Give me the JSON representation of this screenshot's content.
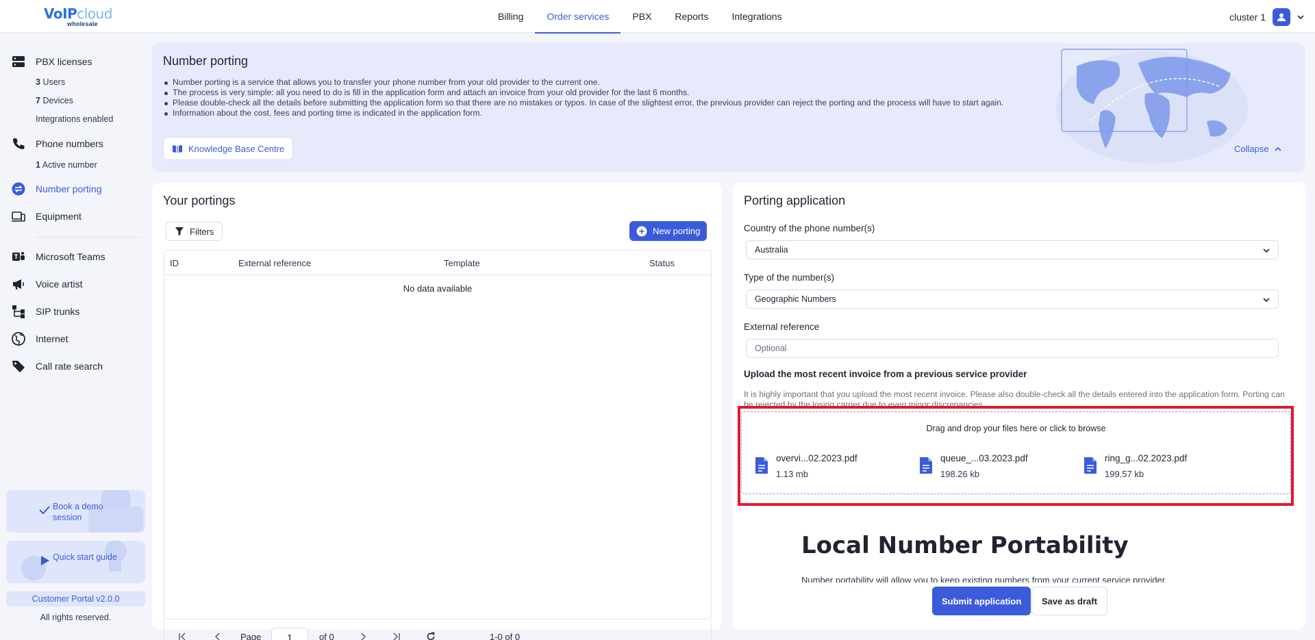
{
  "logo": {
    "brand_main": "VoIP",
    "brand_accent": "cloud",
    "brand_sub": "wholesale"
  },
  "nav": {
    "items": [
      {
        "label": "Billing",
        "active": false
      },
      {
        "label": "Order services",
        "active": true
      },
      {
        "label": "PBX",
        "active": false
      },
      {
        "label": "Reports",
        "active": false
      },
      {
        "label": "Integrations",
        "active": false
      }
    ]
  },
  "user": {
    "name": "cluster 1"
  },
  "sidebar": {
    "pbx_licenses": "PBX licenses",
    "users": {
      "count": "3",
      "label": "Users"
    },
    "devices": {
      "count": "7",
      "label": "Devices"
    },
    "integrations": "Integrations enabled",
    "phone_numbers": "Phone numbers",
    "active_number": {
      "count": "1",
      "label": "Active number"
    },
    "number_porting": "Number porting",
    "equipment": "Equipment",
    "microsoft_teams": "Microsoft Teams",
    "voice_artist": "Voice artist",
    "sip_trunks": "SIP trunks",
    "internet": "Internet",
    "call_rate_search": "Call rate search",
    "book_demo": "Book a demo session",
    "quick_start": "Quick start guide",
    "version": "Customer Portal v2.0.0",
    "rights": "All rights reserved."
  },
  "banner": {
    "title": "Number porting",
    "bullets": [
      "Number porting is a service that allows you to transfer your phone number from your old provider to the current one.",
      "The process is very simple: all you need to do is fill in the application form and attach an invoice from your old provider for the last 6 months.",
      "Please double-check all the details before submitting the application form so that there are no mistakes or typos. In case of the slightest error, the previous provider can reject the porting and the process will have to start again.",
      "Information about the cost, fees and porting time is indicated in the application form."
    ],
    "kb_button": "Knowledge Base Centre",
    "collapse": "Collapse"
  },
  "portings": {
    "title": "Your portings",
    "filters": "Filters",
    "new_porting": "New porting",
    "columns": [
      "ID",
      "External reference",
      "Template",
      "Status"
    ],
    "empty": "No data available",
    "pager": {
      "page_label": "Page",
      "page_value": "1",
      "of_label": "of 0",
      "range": "1-0 of 0"
    }
  },
  "application": {
    "title": "Porting application",
    "country_label": "Country of the phone number(s)",
    "country_value": "Australia",
    "type_label": "Type of the number(s)",
    "type_value": "Geographic Numbers",
    "extref_label": "External reference",
    "extref_placeholder": "Optional",
    "upload_title": "Upload the most recent invoice from a previous service provider",
    "upload_note": "It is highly important that you upload the most recent invoice. Please also double-check all the details entered into the application form. Porting can be rejected by the losing carrier due to even minor discrepancies.",
    "dropzone_text": "Drag and drop your files here or click to browse",
    "files": [
      {
        "name": "overvi...02.2023.pdf",
        "size": "1.13 mb"
      },
      {
        "name": "queue_...03.2023.pdf",
        "size": "198.26 kb"
      },
      {
        "name": "ring_g...02.2023.pdf",
        "size": "199.57 kb"
      }
    ],
    "lnp_title": "Local Number Portability",
    "lnp_text": "Number portability will allow you to keep existing numbers from your current service provider.",
    "submit": "Submit application",
    "draft": "Save as draft"
  },
  "colors": {
    "accent": "#3b5bdb",
    "highlight": "#e0192a",
    "banner_bg": "#e6eafb"
  }
}
